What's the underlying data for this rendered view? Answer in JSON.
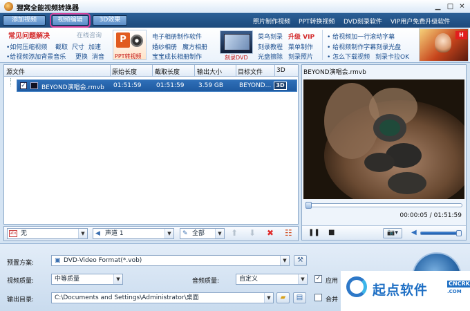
{
  "window": {
    "title": "狸窝全能视频转换器"
  },
  "toolbar": {
    "tabs": [
      {
        "label": "添加视频",
        "active": false
      },
      {
        "label": "视频编辑",
        "active": true
      },
      {
        "label": "3D效果",
        "active": false
      }
    ],
    "links": [
      "照片制作视频",
      "PPT转换视频",
      "DVD刻录软件",
      "VIP用户免费升级软件"
    ]
  },
  "banner": {
    "faq_title": "常见问题解决",
    "online_consult": "在线咨询",
    "col1": [
      {
        "parts": [
          "•如何压缩视频",
          "截取",
          "尺寸",
          "加速"
        ]
      },
      {
        "parts": [
          "•给视频添加背景音乐",
          "更换",
          "消音"
        ]
      }
    ],
    "promo1_caption": "PPT转视频",
    "col2": [
      "电子相册制作软件",
      "婚纱相册",
      "魔方相册",
      "宝宝成长相册制作"
    ],
    "promo2_caption": "刻录DVD",
    "col3": [
      "菜鸟刻录",
      "升级 VIP",
      "刻录教程",
      "菜单制作",
      "光盘擦除",
      "刻录照片"
    ],
    "col4": [
      "• 给视频加一行滚动字幕",
      "• 给视频制作字幕刻录光盘",
      "• 怎么下载视频",
      "刻录卡拉OK"
    ]
  },
  "table": {
    "columns": [
      "源文件",
      "原始长度",
      "截取长度",
      "输出大小",
      "目标文件",
      "3D"
    ],
    "rows": [
      {
        "file": "BEYOND演唱会.rmvb",
        "original_length": "01:51:59",
        "clip_length": "01:51:59",
        "output_size": "3.59 GB",
        "target": "BEYOND...",
        "three_d": "3D",
        "checked": true
      }
    ]
  },
  "preview": {
    "title": "BEYOND演唱会.rmvb",
    "timecode": "00:00:05 / 01:51:59",
    "progress": 0.0007,
    "volume": 1.0
  },
  "filters": {
    "subtitle": "无",
    "audio_track": "声道 1",
    "range": "全部"
  },
  "settings": {
    "preset_label": "预置方案:",
    "preset_value": "DVD-Video Format(*.vob)",
    "video_quality_label": "视频质量:",
    "video_quality_value": "中等质量",
    "audio_quality_label": "音频质量:",
    "audio_quality_value": "自定义",
    "apply_label": "应用",
    "output_dir_label": "输出目录:",
    "output_dir_value": "C:\\Documents and Settings\\Administrator\\桌面",
    "merge_label": "合并"
  },
  "watermark": {
    "text": "起点软件",
    "badge": "CNCRK",
    "domain": ".COM"
  }
}
